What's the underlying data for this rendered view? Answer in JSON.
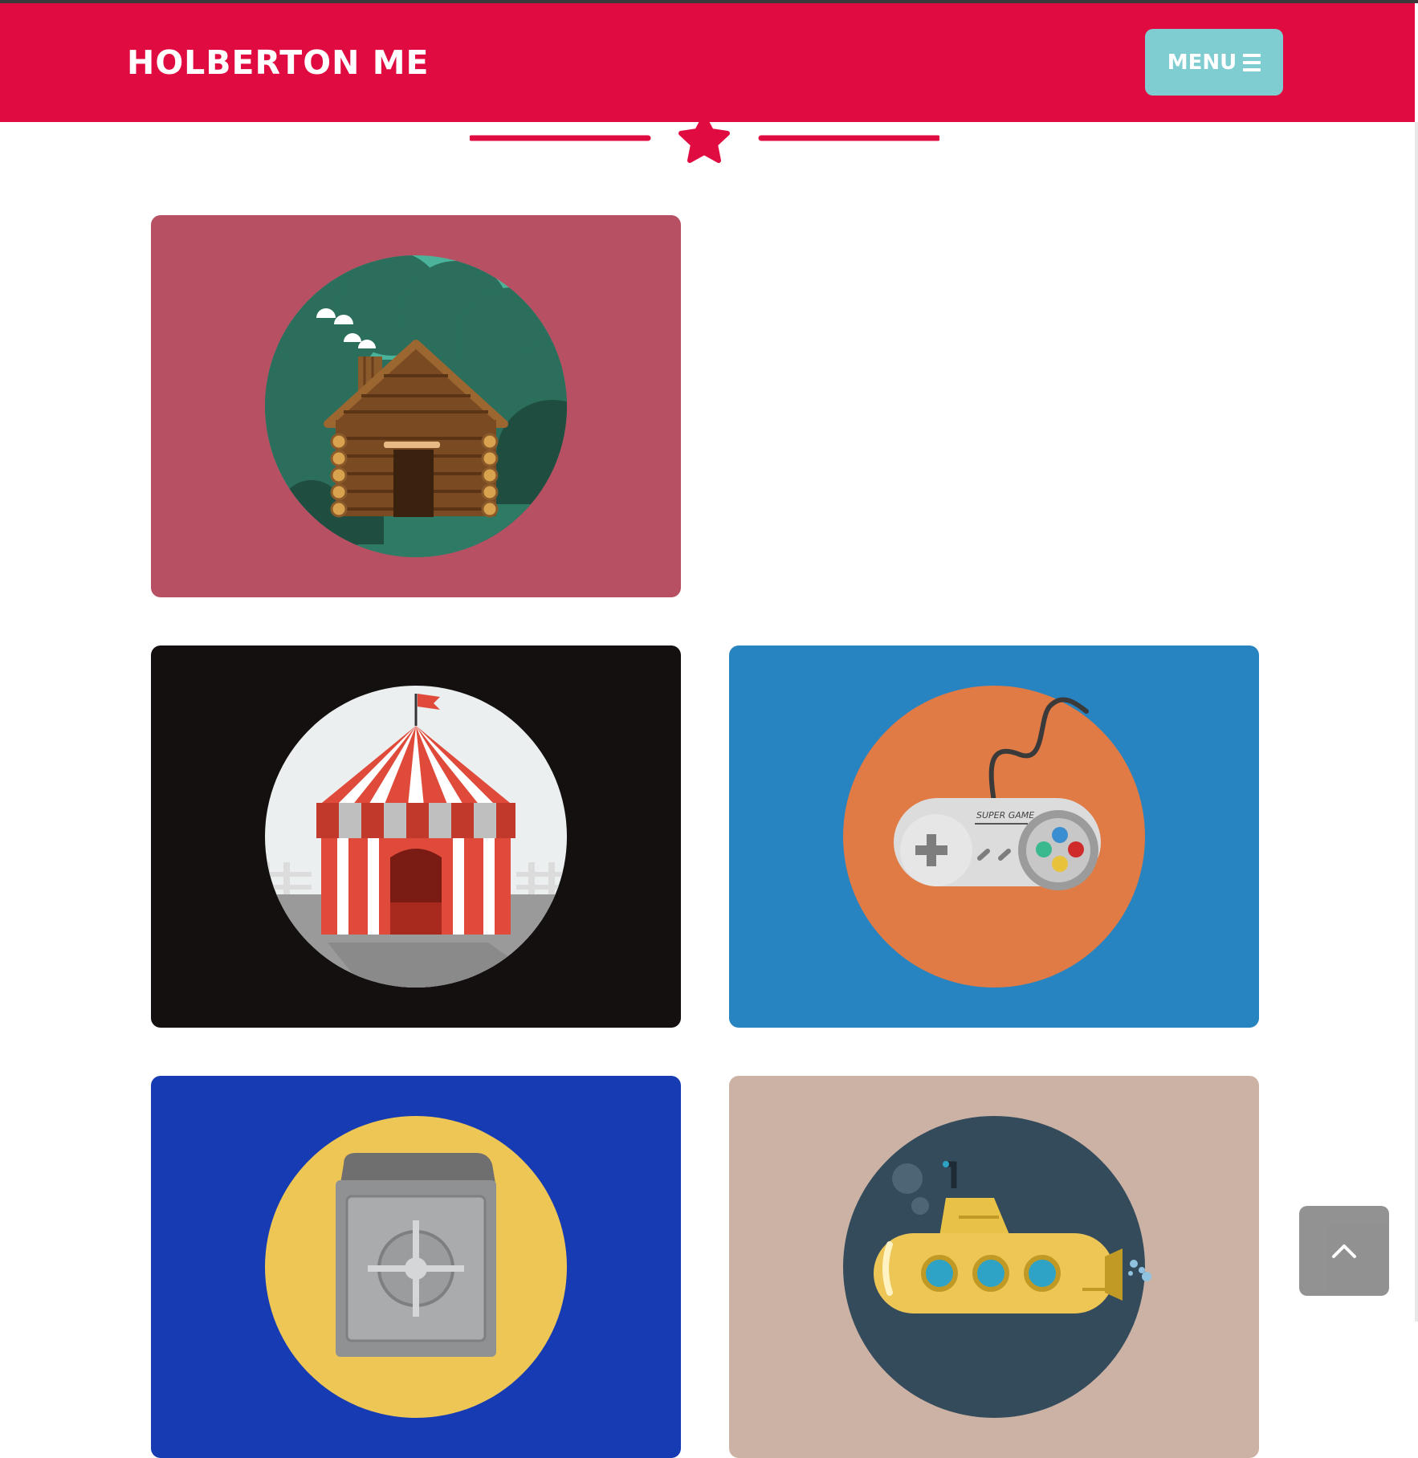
{
  "header": {
    "brand": "HOLBERTON ME",
    "menu_label": "MENU",
    "menu_icon": "hamburger-icon",
    "accent_color": "#e00c41",
    "menu_button_color": "#7fcdd1"
  },
  "divider": {
    "icon": "star-icon"
  },
  "portfolio": {
    "items": [
      {
        "name": "cabin",
        "background": "#b85063",
        "circle": "#4bb39a"
      },
      {
        "name": "circus",
        "background": "#141010",
        "circle": "#eceff0"
      },
      {
        "name": "controller",
        "background": "#2784c1",
        "circle": "#e07b45",
        "controller_label": "SUPER GAME"
      },
      {
        "name": "safe",
        "background": "#163bb2",
        "circle": "#eec656"
      },
      {
        "name": "submarine",
        "background": "#ccb2a4",
        "circle": "#344b5c"
      }
    ]
  },
  "back_to_top": {
    "icon": "chevron-up-icon",
    "color": "#8c8c8c"
  }
}
